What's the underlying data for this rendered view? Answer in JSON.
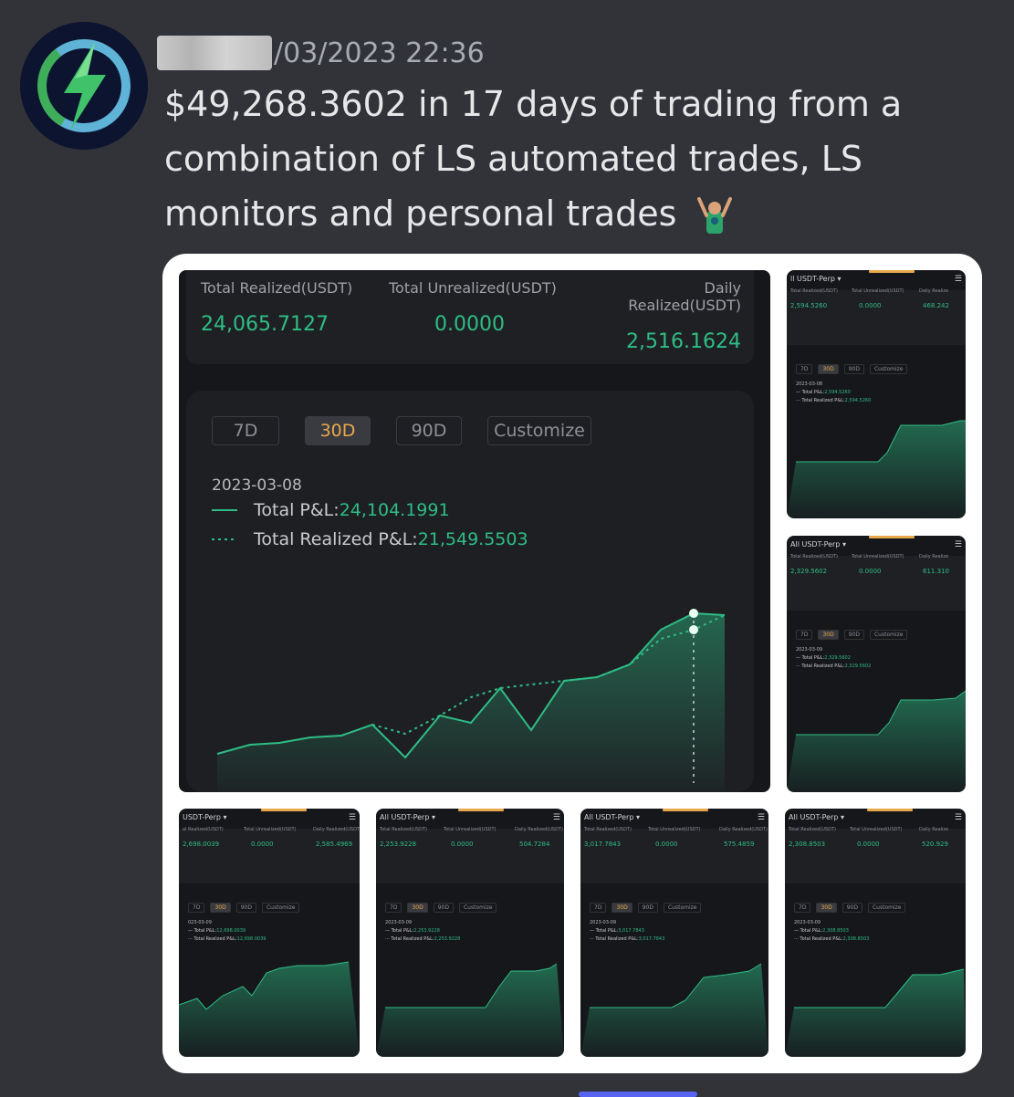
{
  "message": {
    "timestamp": "/03/2023 22:36",
    "text": "$49,268.3602 in 17 days of trading from a combination of LS automated trades, LS monitors and personal trades",
    "avatar_icon": "lightning-bolt-icon",
    "emoji": "raised-hands-person-emoji"
  },
  "main_panel": {
    "stats": [
      {
        "label": "Total Realized(USDT)",
        "value": "24,065.7127"
      },
      {
        "label": "Total Unrealized(USDT)",
        "value": "0.0000"
      },
      {
        "label": "Daily Realized(USDT)",
        "value": "2,516.1624"
      }
    ],
    "tabs": [
      {
        "label": "7D",
        "active": false
      },
      {
        "label": "30D",
        "active": true
      },
      {
        "label": "90D",
        "active": false
      },
      {
        "label": "Customize",
        "active": false
      }
    ],
    "date": "2023-03-08",
    "legend": {
      "total_label": "Total P&L:",
      "total_value": "24,104.1991",
      "realized_label": "Total Realized P&L:",
      "realized_value": "21,549.5503"
    }
  },
  "mini_panels": [
    {
      "title": "ll USDT-Perp ▾",
      "stats": [
        "2,594.5260",
        "0.0000",
        "468.242"
      ],
      "labels": [
        "Total Realized(USDT)",
        "Total Unrealized(USDT)",
        "Daily Realize"
      ],
      "tabs": [
        "7D",
        "30D",
        "90D",
        "Customize"
      ],
      "date": "2023-03-08",
      "total_label": "Total P&L:",
      "total_value": "2,594.5260",
      "realized_label": "Total Realized P&L:",
      "realized_value": "2,594.5260"
    },
    {
      "title": "All USDT-Perp ▾",
      "stats": [
        "2,329.5602",
        "0.0000",
        "611.310"
      ],
      "labels": [
        "Total Realized(USDT)",
        "Total Unrealized(USDT)",
        "Daily Realize"
      ],
      "tabs": [
        "7D",
        "30D",
        "90D",
        "Customize"
      ],
      "date": "2023-03-09",
      "total_label": "Total P&L:",
      "total_value": "2,329.5602",
      "realized_label": "Total Realized P&L:",
      "realized_value": "2,329.5602"
    },
    {
      "title": "USDT-Perp ▾",
      "stats": [
        "2,698.0039",
        "0.0000",
        "2,585.4969"
      ],
      "labels": [
        "al Realized(USDT)",
        "Total Unrealized(USDT)",
        "Daily Realized(USDT)"
      ],
      "tabs": [
        "7D",
        "30D",
        "90D",
        "Customize"
      ],
      "date": "023-03-09",
      "total_label": "Total P&L:",
      "total_value": "12,698.0039",
      "realized_label": "Total Realized P&L:",
      "realized_value": "12,698.0039"
    },
    {
      "title": "All USDT-Perp ▾",
      "stats": [
        "2,253.9228",
        "0.0000",
        "504.7284"
      ],
      "labels": [
        "Total Realized(USDT)",
        "Total Unrealized(USDT)",
        "Daily Realized(USDT)"
      ],
      "tabs": [
        "7D",
        "30D",
        "90D",
        "Customize"
      ],
      "date": "2023-03-09",
      "total_label": "Total P&L:",
      "total_value": "2,253.9228",
      "realized_label": "Total Realized P&L:",
      "realized_value": "2,253.9228"
    },
    {
      "title": "All USDT-Perp ▾",
      "stats": [
        "3,017.7843",
        "0.0000",
        "575.4859"
      ],
      "labels": [
        "Total Realized(USDT)",
        "Total Unrealized(USDT)",
        "Daily Realized(USDT)"
      ],
      "tabs": [
        "7D",
        "30D",
        "90D",
        "Customize"
      ],
      "date": "2023-03-09",
      "total_label": "Total P&L:",
      "total_value": "3,017.7843",
      "realized_label": "Total Realized P&L:",
      "realized_value": "3,017.7843"
    },
    {
      "title": "All USDT-Perp ▾",
      "stats": [
        "2,308.8503",
        "0.0000",
        "520.929"
      ],
      "labels": [
        "Total Realized(USDT)",
        "Total Unrealized(USDT)",
        "Daily Realize"
      ],
      "tabs": [
        "7D",
        "30D",
        "90D",
        "Customize"
      ],
      "date": "2023-03-09",
      "total_label": "Total P&L:",
      "total_value": "2,308.8503",
      "realized_label": "Total Realized P&L:",
      "realized_value": "2,308.8503"
    }
  ],
  "colors": {
    "background": "#313338",
    "panel": "#16171b",
    "positive": "#2ebd85",
    "accent": "#e8a84b"
  }
}
